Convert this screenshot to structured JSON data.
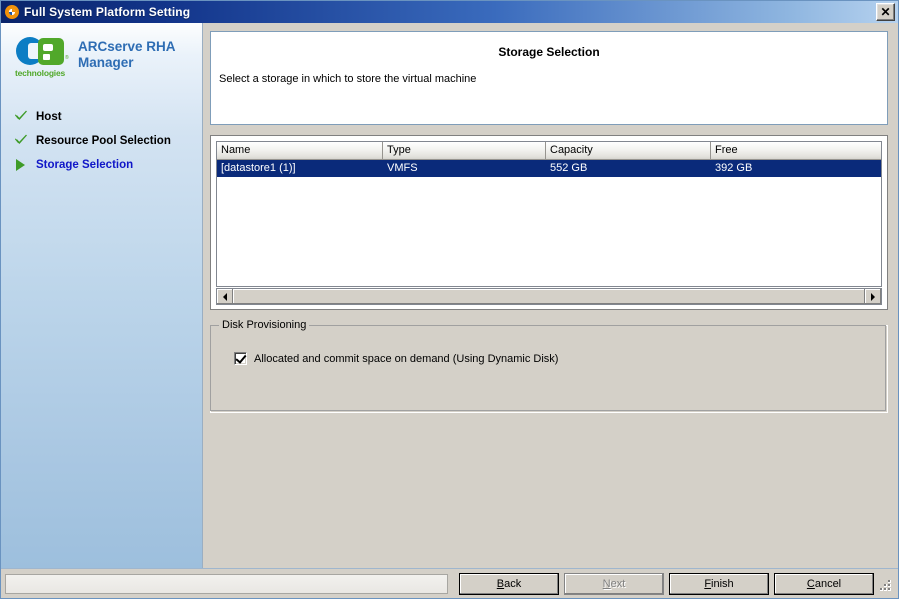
{
  "window": {
    "title": "Full System Platform Setting",
    "icon": "arcserve-swirl-icon",
    "close_label": "✕"
  },
  "sidebar": {
    "brand": {
      "logo_letters": "ca",
      "logo_sub": "technologies",
      "logo_reg": "®",
      "product_line1": "ARCserve RHA",
      "product_line2": "Manager"
    },
    "steps": [
      {
        "label": "Host",
        "state": "done",
        "icon": "check-icon"
      },
      {
        "label": "Resource Pool Selection",
        "state": "done",
        "icon": "check-icon"
      },
      {
        "label": "Storage Selection",
        "state": "current",
        "icon": "arrow-right-icon"
      }
    ]
  },
  "main": {
    "header": {
      "title": "Storage Selection",
      "description": "Select a storage in which to store the virtual machine"
    },
    "storage_table": {
      "columns": [
        "Name",
        "Type",
        "Capacity",
        "Free"
      ],
      "rows": [
        {
          "name": "[datastore1 (1)]",
          "type": "VMFS",
          "capacity": "552 GB",
          "free": "392 GB",
          "selected": true
        }
      ]
    },
    "disk_provisioning": {
      "legend": "Disk Provisioning",
      "checkbox_label": "Allocated and commit space on demand (Using Dynamic Disk)",
      "checkbox_checked": true
    }
  },
  "footer": {
    "status_text": "",
    "buttons": [
      {
        "label": "Back",
        "accel": "B",
        "disabled": false,
        "name": "back-button"
      },
      {
        "label": "Next",
        "accel": "N",
        "disabled": true,
        "name": "next-button"
      },
      {
        "label": "Finish",
        "accel": "F",
        "disabled": false,
        "name": "finish-button"
      },
      {
        "label": "Cancel",
        "accel": "C",
        "disabled": false,
        "name": "cancel-button"
      }
    ]
  },
  "colors": {
    "titlebar_dark": "#0a246a",
    "titlebar_light": "#b6d2ef",
    "selection_blue": "#0a2a7a",
    "current_step_text": "#1016c8",
    "brand_blue": "#2e6db4",
    "ca_blue": "#0c7dc4",
    "ca_green": "#51a82a",
    "dialog_face": "#d4d0c8"
  }
}
